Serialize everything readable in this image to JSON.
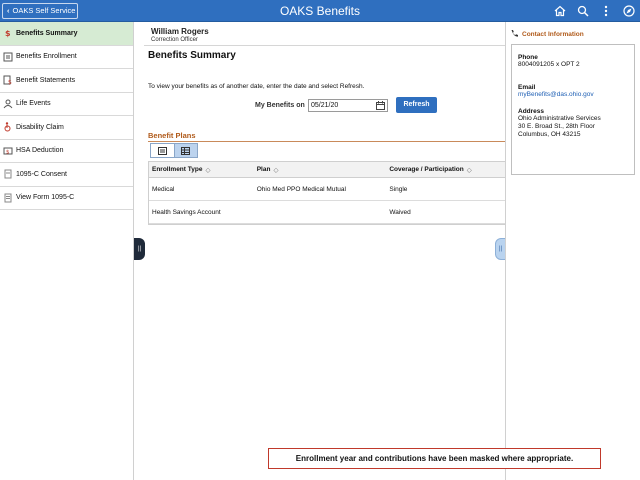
{
  "header": {
    "back_label": "OAKS Self Service",
    "title": "OAKS Benefits",
    "icons": [
      "home-icon",
      "search-icon",
      "more-vertical-icon",
      "compass-icon"
    ]
  },
  "sidebar": {
    "items": [
      {
        "label": "Benefits Summary",
        "icon": "summary-icon",
        "active": true
      },
      {
        "label": "Benefits Enrollment",
        "icon": "enrollment-icon",
        "active": false
      },
      {
        "label": "Benefit Statements",
        "icon": "statements-icon",
        "active": false
      },
      {
        "label": "Life Events",
        "icon": "life-events-icon",
        "active": false
      },
      {
        "label": "Disability Claim",
        "icon": "disability-icon",
        "active": false
      },
      {
        "label": "HSA Deduction",
        "icon": "hsa-icon",
        "active": false
      },
      {
        "label": "1095-C Consent",
        "icon": "consent-icon",
        "active": false
      },
      {
        "label": "View Form 1095-C",
        "icon": "form-icon",
        "active": false
      }
    ]
  },
  "employee": {
    "name": "William Rogers",
    "title": "Correction Officer"
  },
  "main": {
    "page_title": "Benefits Summary",
    "instructions": "To view your benefits as of another date, enter the date and select Refresh.",
    "asof_label": "My Benefits on",
    "asof_value": "05/21/20",
    "refresh_label": "Refresh",
    "section_title": "Benefit Plans",
    "table": {
      "columns": [
        "Enrollment Type",
        "Plan",
        "Coverage / Participation"
      ],
      "rows": [
        [
          "Medical",
          "Ohio Med PPO Medical Mutual",
          "Single"
        ],
        [
          "Health Savings Account",
          "",
          "Waived"
        ]
      ]
    }
  },
  "contact": {
    "heading": "Contact Information",
    "phone_label": "Phone",
    "phone_value": "8004091205 x OPT 2",
    "email_label": "Email",
    "email_value": "myBenefits@das.ohio.gov",
    "address_label": "Address",
    "address_lines": [
      "Ohio Administrative Services",
      "30 E. Broad St., 28th Floor",
      "Columbus, OH 43215"
    ]
  },
  "notice": "Enrollment year and contributions have been masked where appropriate.",
  "colors": {
    "banner": "#2f6fbf",
    "active_nav": "#d6ebd3",
    "section_accent": "#b05a1a",
    "link": "#1e5fb4",
    "notice_border": "#c0392b"
  }
}
